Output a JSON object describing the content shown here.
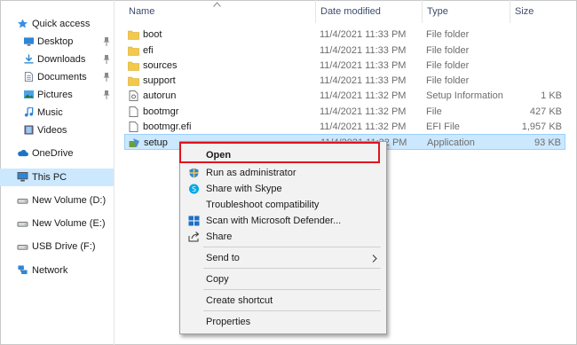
{
  "sidebar": {
    "items": [
      {
        "label": "Quick access",
        "icon": "star-icon",
        "pinned": false
      },
      {
        "label": "Desktop",
        "icon": "desktop-folder-icon",
        "pinned": true
      },
      {
        "label": "Downloads",
        "icon": "downloads-folder-icon",
        "pinned": true
      },
      {
        "label": "Documents",
        "icon": "documents-folder-icon",
        "pinned": true
      },
      {
        "label": "Pictures",
        "icon": "pictures-folder-icon",
        "pinned": true
      },
      {
        "label": "Music",
        "icon": "music-folder-icon",
        "pinned": false
      },
      {
        "label": "Videos",
        "icon": "videos-folder-icon",
        "pinned": false
      },
      {
        "label": "OneDrive",
        "icon": "cloud-icon",
        "pinned": false
      },
      {
        "label": "This PC",
        "icon": "computer-icon",
        "pinned": false
      },
      {
        "label": "New Volume (D:)",
        "icon": "drive-icon",
        "pinned": false
      },
      {
        "label": "New Volume (E:)",
        "icon": "drive-icon",
        "pinned": false
      },
      {
        "label": "USB Drive (F:)",
        "icon": "usb-drive-icon",
        "pinned": false
      },
      {
        "label": "Network",
        "icon": "network-icon",
        "pinned": false
      }
    ]
  },
  "columns": {
    "name": "Name",
    "date": "Date modified",
    "type": "Type",
    "size": "Size"
  },
  "files": [
    {
      "name": "boot",
      "date": "11/4/2021 11:33 PM",
      "type": "File folder",
      "size": "",
      "icon": "folder-icon"
    },
    {
      "name": "efi",
      "date": "11/4/2021 11:33 PM",
      "type": "File folder",
      "size": "",
      "icon": "folder-icon"
    },
    {
      "name": "sources",
      "date": "11/4/2021 11:33 PM",
      "type": "File folder",
      "size": "",
      "icon": "folder-icon"
    },
    {
      "name": "support",
      "date": "11/4/2021 11:33 PM",
      "type": "File folder",
      "size": "",
      "icon": "folder-icon"
    },
    {
      "name": "autorun",
      "date": "11/4/2021 11:32 PM",
      "type": "Setup Information",
      "size": "1 KB",
      "icon": "settings-file-icon"
    },
    {
      "name": "bootmgr",
      "date": "11/4/2021 11:32 PM",
      "type": "File",
      "size": "427 KB",
      "icon": "file-icon"
    },
    {
      "name": "bootmgr.efi",
      "date": "11/4/2021 11:32 PM",
      "type": "EFI File",
      "size": "1,957 KB",
      "icon": "file-icon"
    },
    {
      "name": "setup",
      "date": "11/4/2021 11:32 PM",
      "type": "Application",
      "size": "93 KB",
      "icon": "setup-app-icon"
    }
  ],
  "context_menu": {
    "items": [
      {
        "label": "Open",
        "bold": true,
        "icon": ""
      },
      {
        "label": "Run as administrator",
        "icon": "shield-icon"
      },
      {
        "label": "Share with Skype",
        "icon": "skype-icon"
      },
      {
        "label": "Troubleshoot compatibility",
        "icon": ""
      },
      {
        "label": "Scan with Microsoft Defender...",
        "icon": "defender-icon"
      },
      {
        "label": "Share",
        "icon": "share-icon"
      },
      {
        "label": "Send to",
        "icon": "",
        "submenu": true
      },
      {
        "label": "Copy",
        "icon": ""
      },
      {
        "label": "Create shortcut",
        "icon": ""
      },
      {
        "label": "Properties",
        "icon": ""
      }
    ]
  },
  "colors": {
    "selection": "#cce8ff",
    "highlight_box": "#e0141e",
    "folder": "#f3c94b"
  }
}
